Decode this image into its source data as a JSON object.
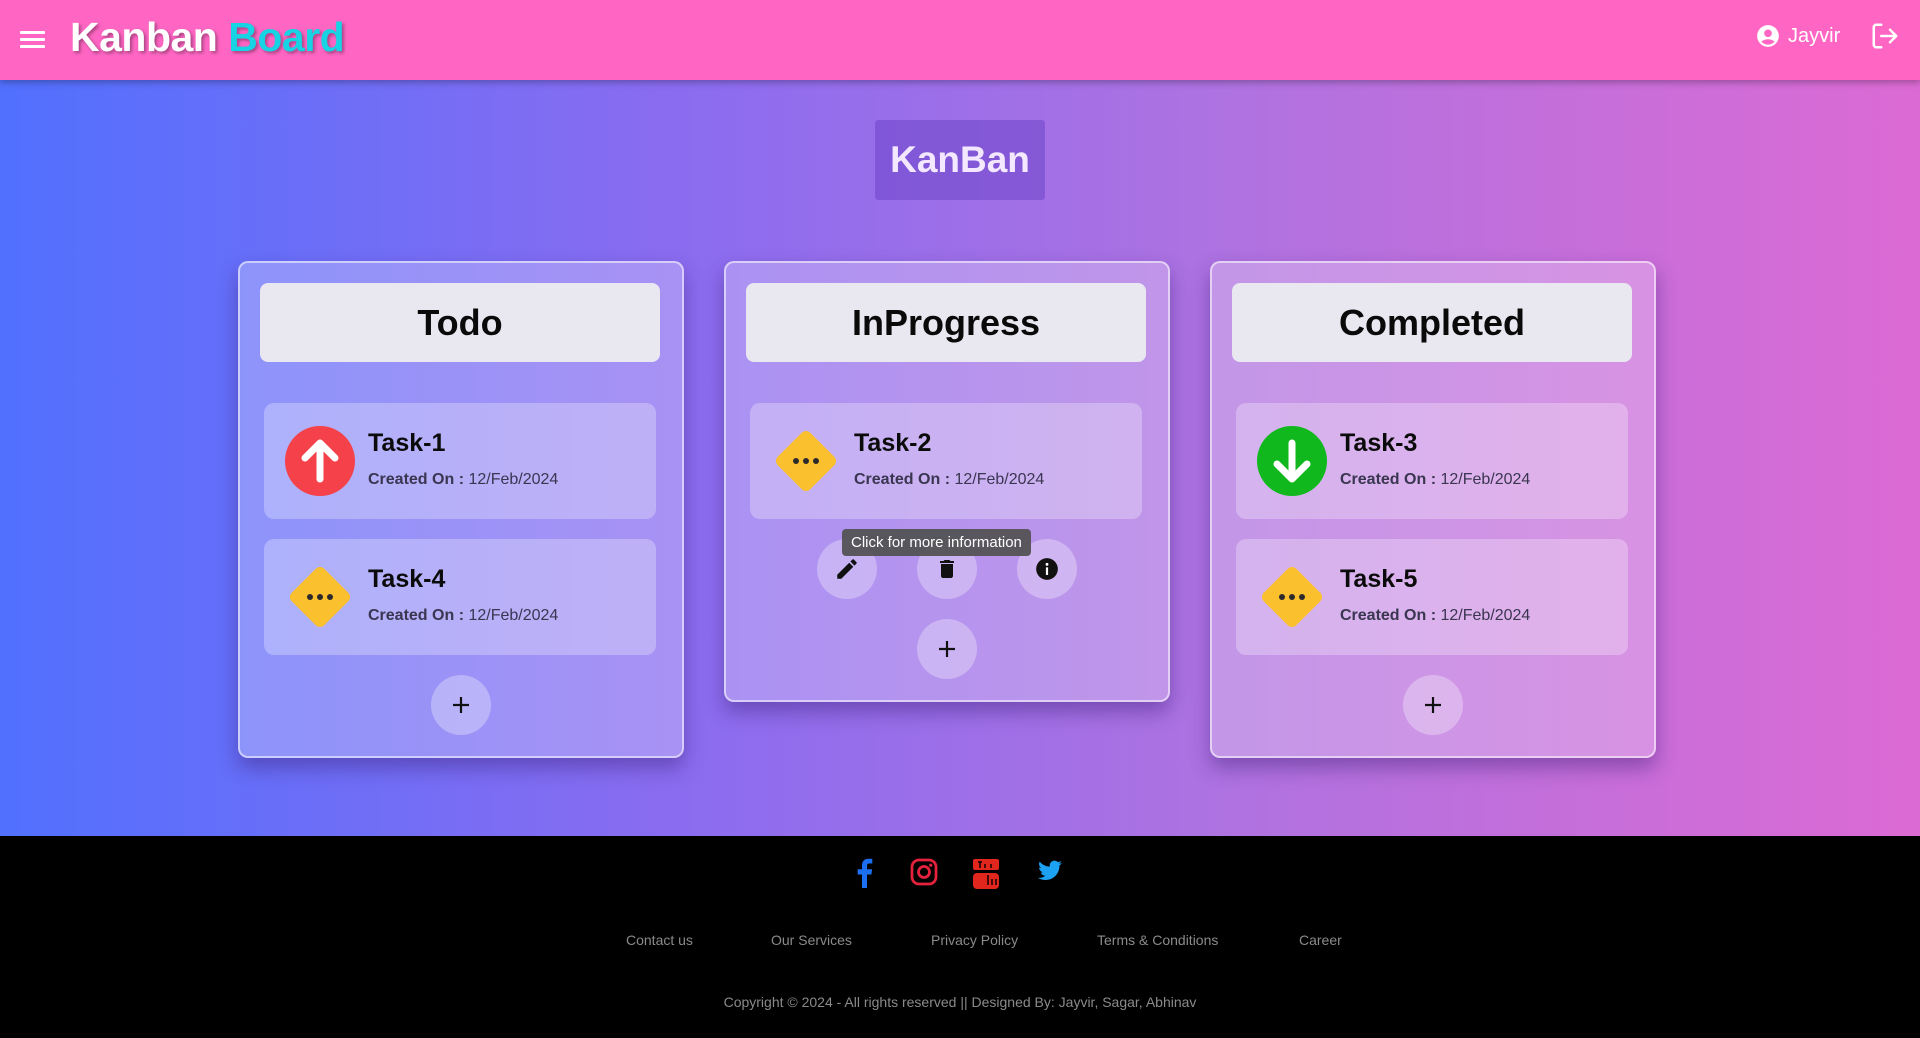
{
  "header": {
    "brand_part1": "Kanban",
    "brand_part2": "Board",
    "username": "Jayvir",
    "bg_color": "#ff66c4",
    "icons": [
      "menu-icon",
      "account-circle-icon",
      "logout-icon"
    ]
  },
  "page": {
    "title": "KanBan"
  },
  "columns": [
    {
      "title": "Todo",
      "tasks": [
        {
          "name": "Task-1",
          "created_label": "Created On :",
          "created_date": "12/Feb/2024",
          "priority_icon": "arrow-up-icon",
          "priority_color": "#f5414a"
        },
        {
          "name": "Task-4",
          "created_label": "Created On :",
          "created_date": "12/Feb/2024",
          "priority_icon": "more-horizontal-icon",
          "priority_color": "#fbc02d"
        }
      ]
    },
    {
      "title": "InProgress",
      "tasks": [
        {
          "name": "Task-2",
          "created_label": "Created On :",
          "created_date": "12/Feb/2024",
          "priority_icon": "more-horizontal-icon",
          "priority_color": "#fbc02d"
        }
      ],
      "tooltip": "Click for more information",
      "actions": [
        "edit-icon",
        "delete-icon",
        "info-icon"
      ]
    },
    {
      "title": "Completed",
      "tasks": [
        {
          "name": "Task-3",
          "created_label": "Created On :",
          "created_date": "12/Feb/2024",
          "priority_icon": "arrow-down-icon",
          "priority_color": "#11b81d"
        },
        {
          "name": "Task-5",
          "created_label": "Created On :",
          "created_date": "12/Feb/2024",
          "priority_icon": "more-horizontal-icon",
          "priority_color": "#fbc02d"
        }
      ]
    }
  ],
  "footer": {
    "social": [
      "facebook-icon",
      "instagram-icon",
      "youtube-icon",
      "twitter-icon"
    ],
    "links": [
      "Contact us",
      "Our Services",
      "Privacy Policy",
      "Terms & Conditions",
      "Career"
    ],
    "copyright": "Copyright © 2024 - All rights reserved || Designed By: Jayvir, Sagar, Abhinav"
  }
}
